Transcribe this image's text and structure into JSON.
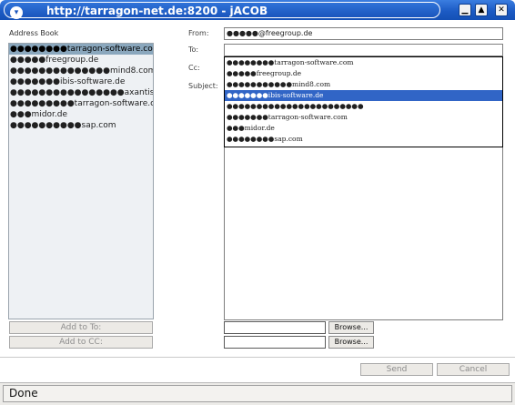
{
  "window": {
    "title": "http://tarragon-net.de:8200 - jACOB",
    "menu_glyph": "▾",
    "minimize_glyph": "▁",
    "maximize_glyph": "▲",
    "close_glyph": "✕"
  },
  "address_book": {
    "label": "Address Book",
    "items": [
      {
        "label": "●●●●●●●●tarragon-software.com",
        "selected": true
      },
      {
        "label": "●●●●●freegroup.de",
        "selected": false
      },
      {
        "label": "●●●●●●●●●●●●●●mind8.com",
        "selected": false
      },
      {
        "label": "●●●●●●●ibis-software.de",
        "selected": false
      },
      {
        "label": "●●●●●●●●●●●●●●●●axantis.com",
        "selected": false
      },
      {
        "label": "●●●●●●●●●tarragon-software.com",
        "selected": false
      },
      {
        "label": "●●●midor.de",
        "selected": false
      },
      {
        "label": "●●●●●●●●●●sap.com",
        "selected": false
      }
    ],
    "add_to_label": "Add to To:",
    "add_cc_label": "Add to CC:"
  },
  "compose": {
    "from_label": "From:",
    "from_value": "●●●●●@freegroup.de",
    "to_label": "To:",
    "cc_label": "Cc:",
    "subject_label": "Subject:",
    "to_value": ""
  },
  "autocomplete": {
    "items": [
      {
        "label": "●●●●●●●●tarragon-software.com",
        "selected": false
      },
      {
        "label": "●●●●●freegroup.de",
        "selected": false
      },
      {
        "label": "●●●●●●●●●●●mind8.com",
        "selected": false
      },
      {
        "label": "●●●●●●●ibis-software.de",
        "selected": true
      },
      {
        "label": "●●●●●●●●●●●●●●●●●●●●●●●",
        "selected": false
      },
      {
        "label": "●●●●●●●tarragon-software.com",
        "selected": false
      },
      {
        "label": "●●●midor.de",
        "selected": false
      },
      {
        "label": "●●●●●●●●sap.com",
        "selected": false
      }
    ]
  },
  "attachments": {
    "browse_label": "Browse..."
  },
  "actions": {
    "send_label": "Send",
    "cancel_label": "Cancel"
  },
  "status": {
    "text": "Done"
  }
}
